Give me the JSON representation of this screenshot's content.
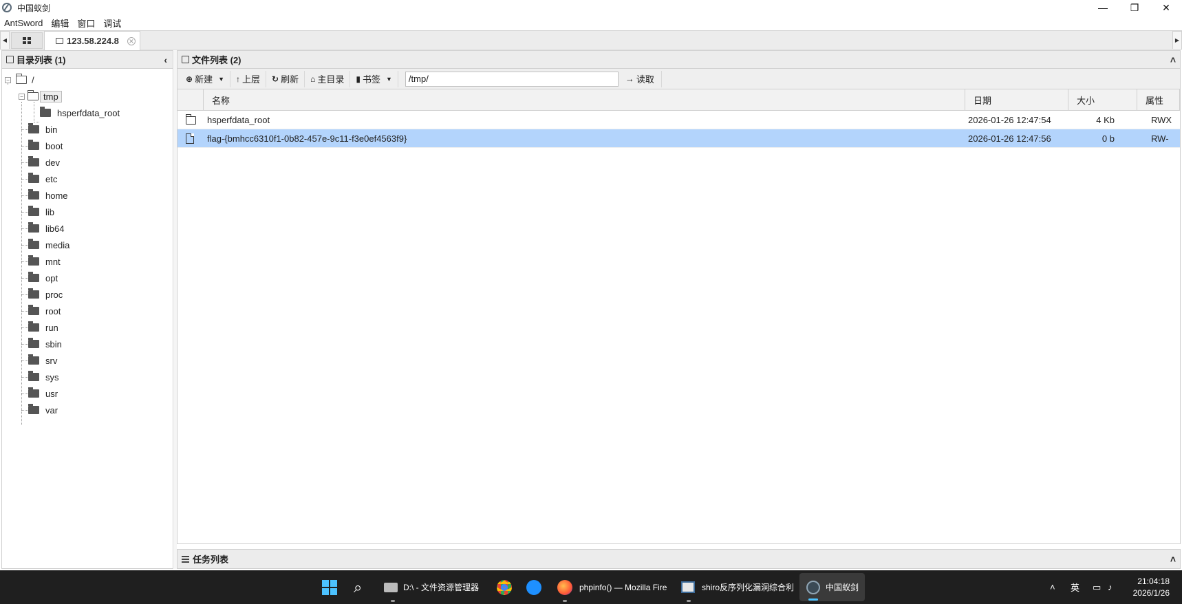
{
  "window": {
    "title": "中国蚁剑",
    "controls": [
      "—",
      "❐",
      "✕"
    ]
  },
  "menu": [
    "AntSword",
    "编辑",
    "窗口",
    "调试"
  ],
  "tabs": {
    "active_label": "123.58.224.8"
  },
  "left_panel": {
    "title": "目录列表 (1)",
    "collapse_icon": "chevron-left-icon",
    "root": "/",
    "open_folder": "tmp",
    "open_children": [
      "hsperfdata_root"
    ],
    "folders": [
      "bin",
      "boot",
      "dev",
      "etc",
      "home",
      "lib",
      "lib64",
      "media",
      "mnt",
      "opt",
      "proc",
      "root",
      "run",
      "sbin",
      "srv",
      "sys",
      "usr",
      "var"
    ]
  },
  "right_panel": {
    "title": "文件列表 (2)",
    "toolbar": {
      "new_label": "新建",
      "up_label": "上层",
      "refresh_label": "刷新",
      "home_label": "主目录",
      "bookmark_label": "书签",
      "path_value": "/tmp/",
      "read_label": "读取"
    },
    "columns": {
      "name": "名称",
      "date": "日期",
      "size": "大小",
      "attr": "属性"
    },
    "files": [
      {
        "type": "folder",
        "name": "hsperfdata_root",
        "date": "2026-01-26 12:47:54",
        "size": "4 Kb",
        "attr": "RWX",
        "selected": false
      },
      {
        "type": "file",
        "name": "flag-{bmhcc6310f1-0b82-457e-9c11-f3e0ef4563f9}",
        "date": "2026-01-26 12:47:56",
        "size": "0 b",
        "attr": "RW-",
        "selected": true
      }
    ]
  },
  "task_panel": {
    "title": "任务列表"
  },
  "taskbar": {
    "apps": [
      {
        "label": "D:\\ - 文件资源管理器"
      },
      {
        "label": "phpinfo() — Mozilla Fire"
      },
      {
        "label": "shiro反序列化漏洞综合利"
      },
      {
        "label": "中国蚁剑"
      }
    ],
    "tray": {
      "ime": "英"
    },
    "time": "21:04:18",
    "date": "2026/1/26"
  },
  "colors": {
    "selection": "#b3d4fc",
    "taskbar_bg": "#1f1f1f",
    "windows_blue": "#4cc2ff"
  }
}
